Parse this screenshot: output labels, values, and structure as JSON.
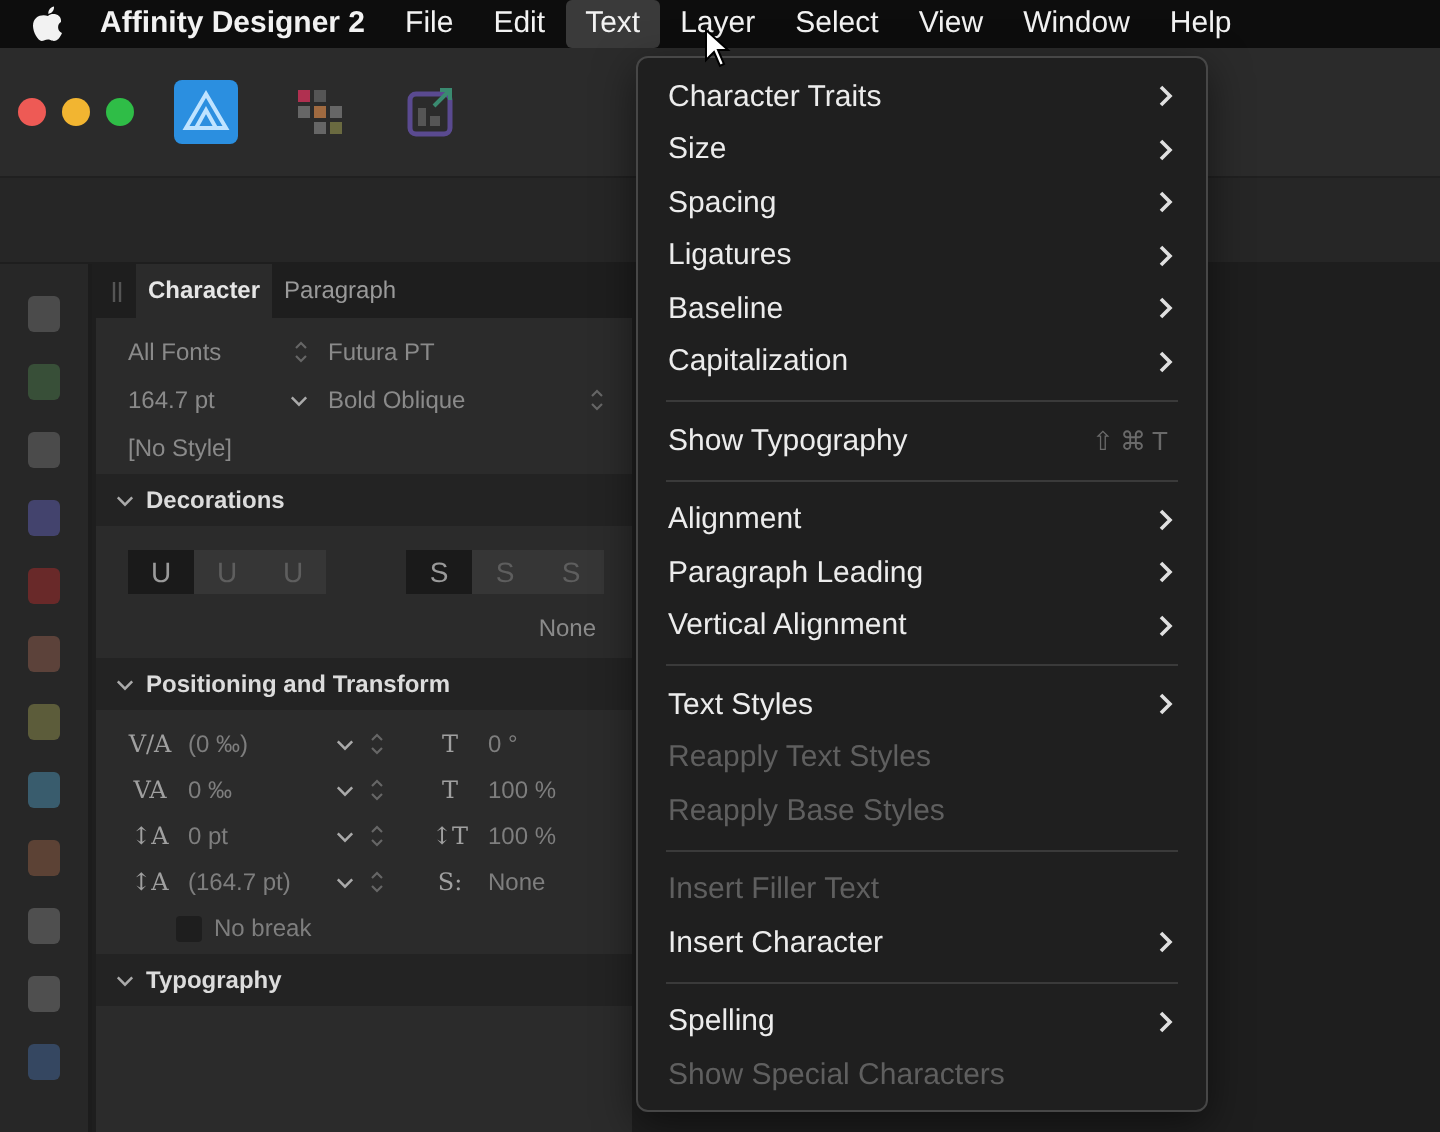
{
  "menubar": {
    "items": [
      {
        "label": "Affinity Designer 2",
        "kind": "app",
        "selected": false
      },
      {
        "label": "File",
        "kind": "menu",
        "selected": false
      },
      {
        "label": "Edit",
        "kind": "menu",
        "selected": false
      },
      {
        "label": "Text",
        "kind": "menu",
        "selected": true
      },
      {
        "label": "Layer",
        "kind": "menu",
        "selected": false
      },
      {
        "label": "Select",
        "kind": "menu",
        "selected": false
      },
      {
        "label": "View",
        "kind": "menu",
        "selected": false
      },
      {
        "label": "Window",
        "kind": "menu",
        "selected": false
      },
      {
        "label": "Help",
        "kind": "menu",
        "selected": false
      }
    ]
  },
  "text_menu": {
    "items": [
      {
        "kind": "item",
        "label": "Character Traits",
        "submenu": true,
        "disabled": false
      },
      {
        "kind": "item",
        "label": "Size",
        "submenu": true,
        "disabled": false
      },
      {
        "kind": "item",
        "label": "Spacing",
        "submenu": true,
        "disabled": false
      },
      {
        "kind": "item",
        "label": "Ligatures",
        "submenu": true,
        "disabled": false
      },
      {
        "kind": "item",
        "label": "Baseline",
        "submenu": true,
        "disabled": false
      },
      {
        "kind": "item",
        "label": "Capitalization",
        "submenu": true,
        "disabled": false
      },
      {
        "kind": "separator"
      },
      {
        "kind": "item",
        "label": "Show Typography",
        "submenu": false,
        "disabled": false,
        "shortcut": "⇧⌘T"
      },
      {
        "kind": "separator"
      },
      {
        "kind": "item",
        "label": "Alignment",
        "submenu": true,
        "disabled": false
      },
      {
        "kind": "item",
        "label": "Paragraph Leading",
        "submenu": true,
        "disabled": false
      },
      {
        "kind": "item",
        "label": "Vertical Alignment",
        "submenu": true,
        "disabled": false
      },
      {
        "kind": "separator"
      },
      {
        "kind": "item",
        "label": "Text Styles",
        "submenu": true,
        "disabled": false
      },
      {
        "kind": "item",
        "label": "Reapply Text Styles",
        "submenu": false,
        "disabled": true
      },
      {
        "kind": "item",
        "label": "Reapply Base Styles",
        "submenu": false,
        "disabled": true
      },
      {
        "kind": "separator"
      },
      {
        "kind": "item",
        "label": "Insert Filler Text",
        "submenu": false,
        "disabled": true
      },
      {
        "kind": "item",
        "label": "Insert Character",
        "submenu": true,
        "disabled": false
      },
      {
        "kind": "separator"
      },
      {
        "kind": "item",
        "label": "Spelling",
        "submenu": true,
        "disabled": false
      },
      {
        "kind": "item",
        "label": "Show Special Characters",
        "submenu": false,
        "disabled": true
      }
    ]
  },
  "panel": {
    "tabs": [
      {
        "label": "Character",
        "selected": true
      },
      {
        "label": "Paragraph",
        "selected": false
      }
    ],
    "font_collection": "All Fonts",
    "font_family": "Futura PT",
    "font_size": "164.7 pt",
    "font_style": "Bold Oblique",
    "text_style": "[No Style]",
    "decorations": {
      "title": "Decorations",
      "expanded": true,
      "underline_buttons": [
        {
          "label": "U",
          "selected": true
        },
        {
          "label": "U",
          "selected": false
        },
        {
          "label": "U",
          "selected": false
        }
      ],
      "strike_buttons": [
        {
          "label": "S",
          "selected": true
        },
        {
          "label": "S",
          "selected": false
        },
        {
          "label": "S",
          "selected": false
        }
      ],
      "decoration_fill": "None"
    },
    "positioning": {
      "title": "Positioning and Transform",
      "expanded": true,
      "left_fields": [
        {
          "glyph": "V/A",
          "value": "(0 ‰)"
        },
        {
          "glyph": "VA",
          "value": "0 ‰"
        },
        {
          "glyph": "↕A",
          "value": "0 pt"
        },
        {
          "glyph": "↕A",
          "value": "(164.7 pt)"
        }
      ],
      "right_fields": [
        {
          "glyph": "T",
          "value": "0 °"
        },
        {
          "glyph": "T",
          "value": "100 %"
        },
        {
          "glyph": "↕T",
          "value": "100 %"
        },
        {
          "glyph": "S:",
          "value": "None"
        }
      ],
      "no_break": {
        "label": "No break",
        "checked": false
      }
    },
    "typography": {
      "title": "Typography",
      "expanded": true
    }
  }
}
